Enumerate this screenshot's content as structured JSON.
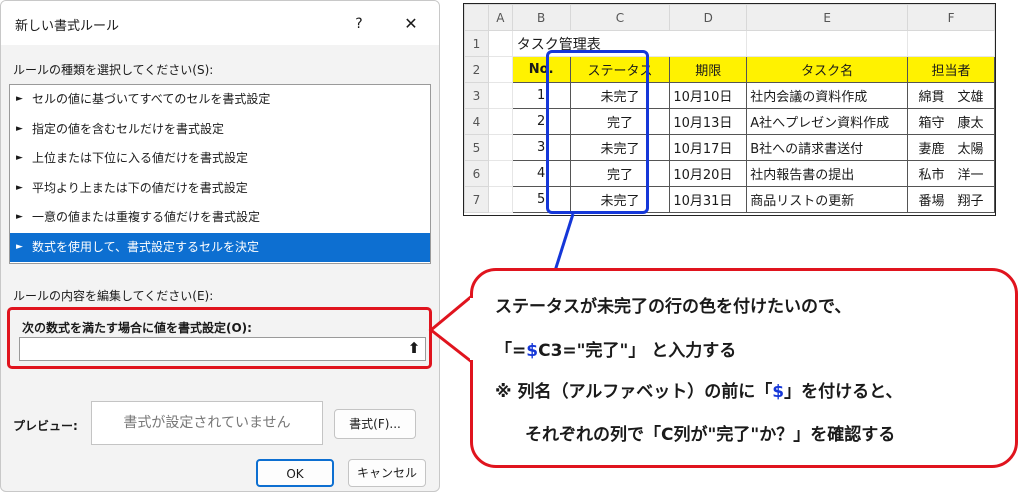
{
  "dialog": {
    "title": "新しい書式ルール",
    "help": "?",
    "close": "✕",
    "rule_type_label": "ルールの種類を選択してください(S):",
    "rules": [
      {
        "label": "セルの値に基づいてすべてのセルを書式設定",
        "selected": false
      },
      {
        "label": "指定の値を含むセルだけを書式設定",
        "selected": false
      },
      {
        "label": "上位または下位に入る値だけを書式設定",
        "selected": false
      },
      {
        "label": "平均より上または下の値だけを書式設定",
        "selected": false
      },
      {
        "label": "一意の値または重複する値だけを書式設定",
        "selected": false
      },
      {
        "label": "数式を使用して、書式設定するセルを決定",
        "selected": true
      }
    ],
    "edit_label": "ルールの内容を編集してください(E):",
    "formula_label": "次の数式を満たす場合に値を書式設定(O):",
    "formula_value": "",
    "preview_label": "プレビュー:",
    "preview_text": "書式が設定されていません",
    "format_button": "書式(F)...",
    "ok_button": "OK",
    "cancel_button": "キャンセル"
  },
  "sheet": {
    "columns": [
      "A",
      "B",
      "C",
      "D",
      "E",
      "F"
    ],
    "rows": [
      "1",
      "2",
      "3",
      "4",
      "5",
      "6",
      "7"
    ],
    "title": "タスク管理表",
    "headers": [
      "No.",
      "ステータス",
      "期限",
      "タスク名",
      "担当者"
    ],
    "data": [
      [
        "1",
        "未完了",
        "10月10日",
        "社内会議の資料作成",
        "綿貫　文雄"
      ],
      [
        "2",
        "完了",
        "10月13日",
        "A社へプレゼン資料作成",
        "箱守　康太"
      ],
      [
        "3",
        "未完了",
        "10月17日",
        "B社への請求書送付",
        "妻鹿　太陽"
      ],
      [
        "4",
        "完了",
        "10月20日",
        "社内報告書の提出",
        "私市　洋一"
      ],
      [
        "5",
        "未完了",
        "10月31日",
        "商品リストの更新",
        "番場　翔子"
      ]
    ],
    "highlight_color": "#fff200"
  },
  "callout": {
    "line1": "ステータスが未完了の行の色を付けたいので、",
    "line2_a": "「=",
    "line2_dollar": "$",
    "line2_b": "C3=\"完了\"」 と入力する",
    "line3_a": "※ 列名（アルファベット）の前に「",
    "line3_dollar": "$",
    "line3_b": "」を付けると、",
    "line4": "それぞれの列で「C列が\"完了\"か？」を確認する",
    "border_color": "#e0141e",
    "accent_color": "#1537d8"
  }
}
